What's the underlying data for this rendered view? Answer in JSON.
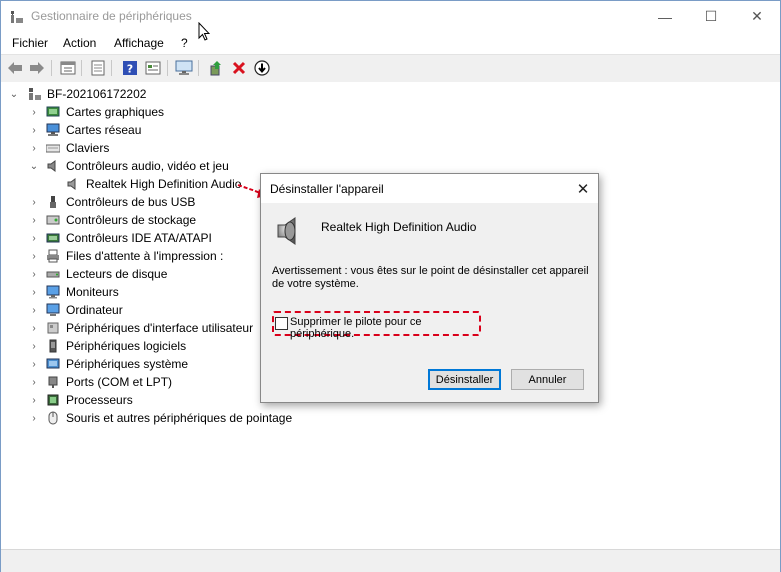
{
  "window": {
    "title": "Gestionnaire de périphériques",
    "minimize_glyph": "—",
    "maximize_glyph": "☐",
    "close_glyph": "✕"
  },
  "menu": {
    "items": [
      "Fichier",
      "Action",
      "Affichage",
      "?"
    ]
  },
  "toolbar": {
    "icons": [
      "back-icon",
      "forward-icon",
      "properties-icon",
      "print-icon",
      "help-icon",
      "view-icon",
      "monitor-icon",
      "update-driver-icon",
      "uninstall-icon",
      "disable-icon"
    ]
  },
  "tree": {
    "root": "BF-202106172202",
    "categories": [
      {
        "label": "Cartes graphiques",
        "icon": "display-adapter-icon",
        "expander": "›"
      },
      {
        "label": "Cartes réseau",
        "icon": "network-adapter-icon",
        "expander": "›"
      },
      {
        "label": "Claviers",
        "icon": "keyboard-icon",
        "expander": "›"
      },
      {
        "label": "Contrôleurs audio, vidéo et jeu",
        "icon": "audio-icon",
        "expander": "⌄",
        "expanded": true
      },
      {
        "label": "Realtek High Definition Audio",
        "icon": "speaker-icon",
        "child": true
      },
      {
        "label": "Contrôleurs de bus USB",
        "icon": "usb-icon",
        "expander": "›"
      },
      {
        "label": "Contrôleurs de stockage",
        "icon": "storage-icon",
        "expander": "›"
      },
      {
        "label": "Contrôleurs IDE ATA/ATAPI",
        "icon": "ide-icon",
        "expander": "›"
      },
      {
        "label": "Files d'attente à l'impression :",
        "icon": "printer-icon",
        "expander": "›"
      },
      {
        "label": "Lecteurs de disque",
        "icon": "disk-icon",
        "expander": "›"
      },
      {
        "label": "Moniteurs",
        "icon": "monitor-icon",
        "expander": "›"
      },
      {
        "label": "Ordinateur",
        "icon": "computer-icon",
        "expander": "›"
      },
      {
        "label": "Périphériques d'interface utilisateur",
        "icon": "hid-icon",
        "expander": "›"
      },
      {
        "label": "Périphériques logiciels",
        "icon": "software-device-icon",
        "expander": "›"
      },
      {
        "label": "Périphériques système",
        "icon": "system-icon",
        "expander": "›"
      },
      {
        "label": "Ports (COM et LPT)",
        "icon": "port-icon",
        "expander": "›"
      },
      {
        "label": "Processeurs",
        "icon": "processor-icon",
        "expander": "›"
      },
      {
        "label": "Souris et autres périphériques de pointage",
        "icon": "mouse-icon",
        "expander": "›"
      }
    ]
  },
  "dialog": {
    "title": "Désinstaller l'appareil",
    "close_glyph": "✕",
    "device_name": "Realtek High Definition Audio",
    "warning": "Avertissement : vous êtes sur le point de désinstaller cet appareil de votre système.",
    "checkbox_label": "Supprimer le pilote pour ce périphérique.",
    "checkbox_checked": false,
    "uninstall_label": "Désinstaller",
    "cancel_label": "Annuler"
  },
  "colors": {
    "highlight": "#d9001a",
    "accent": "#0078d7"
  }
}
